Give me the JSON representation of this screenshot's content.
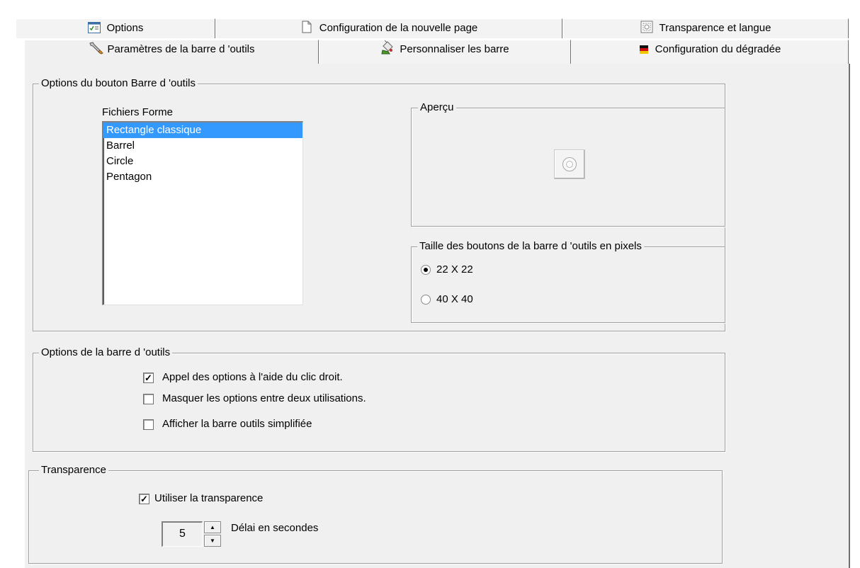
{
  "tabs": {
    "row1": [
      {
        "label": "Options",
        "icon": "options-window-icon"
      },
      {
        "label": "Configuration de la nouvelle page",
        "icon": "page-icon"
      },
      {
        "label": "Transparence et langue",
        "icon": "transparency-icon"
      }
    ],
    "row2": [
      {
        "label": "Paramètres de la barre d 'outils",
        "icon": "wrench-icon",
        "active": true
      },
      {
        "label": "Personnaliser les barre",
        "icon": "paint-bucket-icon"
      },
      {
        "label": "Configuration du dégradée",
        "icon": "gradient-flag-icon"
      }
    ]
  },
  "button_options": {
    "title": "Options du bouton Barre d 'outils",
    "list_label": "Fichiers Forme",
    "shapes": [
      "Rectangle classique",
      "Barrel",
      "Circle",
      "Pentagon"
    ],
    "selected_shape": "Rectangle classique",
    "preview_title": "Aperçu",
    "size_title": "Taille des boutons de la barre d 'outils en pixels",
    "sizes": [
      {
        "label": "22 X 22",
        "selected": true
      },
      {
        "label": "40 X 40",
        "selected": false
      }
    ]
  },
  "toolbar_options": {
    "title": "Options de la barre d 'outils",
    "checkboxes": [
      {
        "label": "Appel des options à l'aide du clic droit.",
        "checked": true
      },
      {
        "label": "Masquer les options entre deux utilisations.",
        "checked": false
      },
      {
        "label": "Afficher la barre outils simplifiée",
        "checked": false
      }
    ]
  },
  "transparency": {
    "title": "Transparence",
    "use_label": "Utiliser la transparence",
    "use_checked": true,
    "delay_value": "5",
    "delay_label": "Délai en secondes"
  },
  "colors": {
    "selection": "#3399ff",
    "panel": "#f0f0f0",
    "border": "#a0a0a0"
  }
}
